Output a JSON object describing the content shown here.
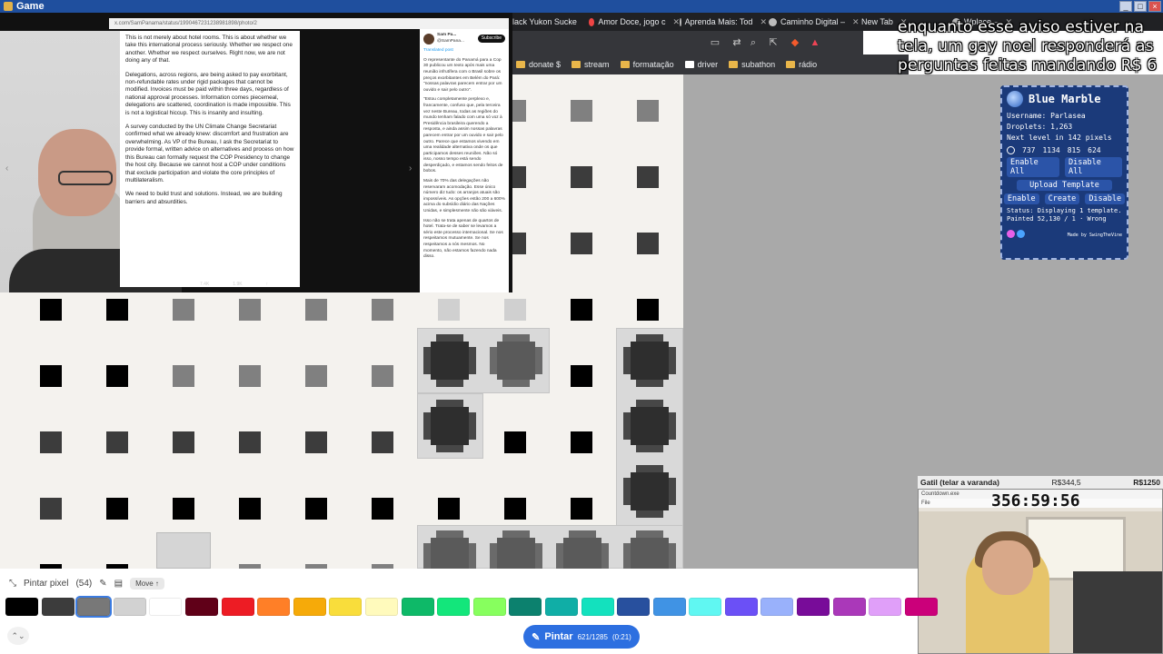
{
  "titlebar": {
    "title": "Game",
    "controls": [
      "_",
      "□",
      "×"
    ]
  },
  "tabs": [
    {
      "label": "lack Yukon Sucke",
      "has_close": false,
      "icon": "favicon-dot"
    },
    {
      "label": "Amor Doce, jogo c",
      "has_close": true,
      "icon": "favicon-dot"
    },
    {
      "label": "Aprenda Mais: Tod",
      "has_close": true,
      "icon": "favicon-dot-gray"
    },
    {
      "label": "Caminho Digital –",
      "has_close": true,
      "icon": "favicon-dot-gray"
    },
    {
      "label": "New Tab",
      "has_close": true,
      "icon": ""
    },
    {
      "label": "Wplace –",
      "has_close": true,
      "icon": "favicon-dot-gray"
    }
  ],
  "bookmarks": [
    "donate $",
    "stream",
    "formatação",
    "driver",
    "subathon",
    "rádio"
  ],
  "caption": "enquanto esse aviso estiver na tela, um gay noel responderá as perguntas feitas mandando R$ 6",
  "article": {
    "url": "x.com/SamPanama/status/1990467231238981898/photo/2",
    "paragraphs": [
      "This is not merely about hotel rooms. This is about whether we take this international process seriously. Whether we respect one another. Whether we respect ourselves. Right now, we are not doing any of that.",
      "Delegations, across regions, are being asked to pay exorbitant, non-refundable rates under rigid packages that cannot be modified. Invoices must be paid within three days, regardless of national approval processes. Information comes piecemeal, delegations are scattered, coordination is made impossible. This is not a logistical hiccup. This is insanity and insulting.",
      "A survey conducted by the UN Climate Change Secretariat confirmed what we already knew: discomfort and frustration are overwhelming. As VP of the Bureau, I ask the Secretariat to provide formal, written advice on alternatives and process on how this Bureau can formally request the COP Presidency to change the host city. Because we cannot host a COP under conditions that exclude participation and violate the core principles of multilateralism.",
      "We need to build trust and solutions. Instead, we are building barriers and absurdities."
    ],
    "stats": [
      "7.4K",
      "1.9K",
      "↑"
    ]
  },
  "tweet": {
    "author": "Sam Pa...",
    "handle": "@SamPana...",
    "subscribe_label": "Subscribe",
    "meta": "Translated post",
    "paragraphs": [
      "O representante do Panamá para a Cop 30 publicou um texto após mais uma reunião infrutífera com o Brasil sobre os preços exorbitantes em Belém do Pará: \"nossas palavras parecem entrar por um ouvido e sair pelo outro\".",
      "\"Estou completamente perplexo e, francamente, confuso que, pela terceira vez neste Bureau, todas as regiões do mundo tenham falado com uma só voz à Presidência brasileira querendo a resposta, e ainda assim nossas palavras parecem entrar por um ouvido e sair pelo outro. Parece que estamos vivendo em uma realidade alternativa onde os que participamos desses reuniões. Não só isso, nosso tempo está sendo desperdiçado, e estamos sendo feitos de bobos.",
      "Mais de 70% das delegações não reservaram acomodação. Esse único número diz tudo: os arranjos atuais são impossíveis. As opções estão 200 a 600% acima do subsídio diário das Nações Unidas, e simplesmente não são viáveis.",
      "Isso não se trata apenas de quartos de hotel. Trata-se de saber se levamos a sério este processo internacional. Se nos respeitamos mutuamente. Se nos respeitamos a nós mesmos. No momento, não estamos fazendo nada disso."
    ]
  },
  "blue_marble": {
    "title": "Blue Marble",
    "username_line": "Username: Parlasea",
    "droplets_line": "Droplets: 1,263",
    "next_level_line": "Next level in 142 pixels",
    "coords": [
      "737",
      "1134",
      "815",
      "624"
    ],
    "buttons_row1": [
      "Enable All",
      "Disable All"
    ],
    "upload_label": "Upload Template",
    "buttons_row3": [
      "Enable",
      "Create",
      "Disable"
    ],
    "status": "Status: Displaying 1 template.\nPainted 52,130 / 1 · Wrong",
    "made_by": "Made by SwingTheVine"
  },
  "cam2": {
    "header_left": "Gatil (telar a varanda)",
    "header_mid": "R$344,5",
    "header_right": "R$1250",
    "app_label": "Countdown.exe",
    "file_label": "File",
    "timer": "356:59:56"
  },
  "bottom": {
    "mode_label": "Pintar pixel",
    "mode_count": "(54)",
    "move_label": "Move ↑",
    "paint_label": "Pintar",
    "paint_count": "621/1285",
    "paint_time": "(0:21)"
  },
  "palette": [
    "#000000",
    "#3c3c3c",
    "#787878",
    "#d2d2d2",
    "#ffffff",
    "#600018",
    "#ed1c24",
    "#ff7f27",
    "#f6aa09",
    "#f9dd3b",
    "#fffabc",
    "#0eb968",
    "#13e67b",
    "#87ff5e",
    "#0c816e",
    "#10aea6",
    "#13e1be",
    "#28509e",
    "#4093e4",
    "#60f7f2",
    "#6b50f6",
    "#99b1fb",
    "#780c99",
    "#aa38b9",
    "#e09ff9",
    "#cb007a"
  ],
  "palette_selected_index": 2
}
